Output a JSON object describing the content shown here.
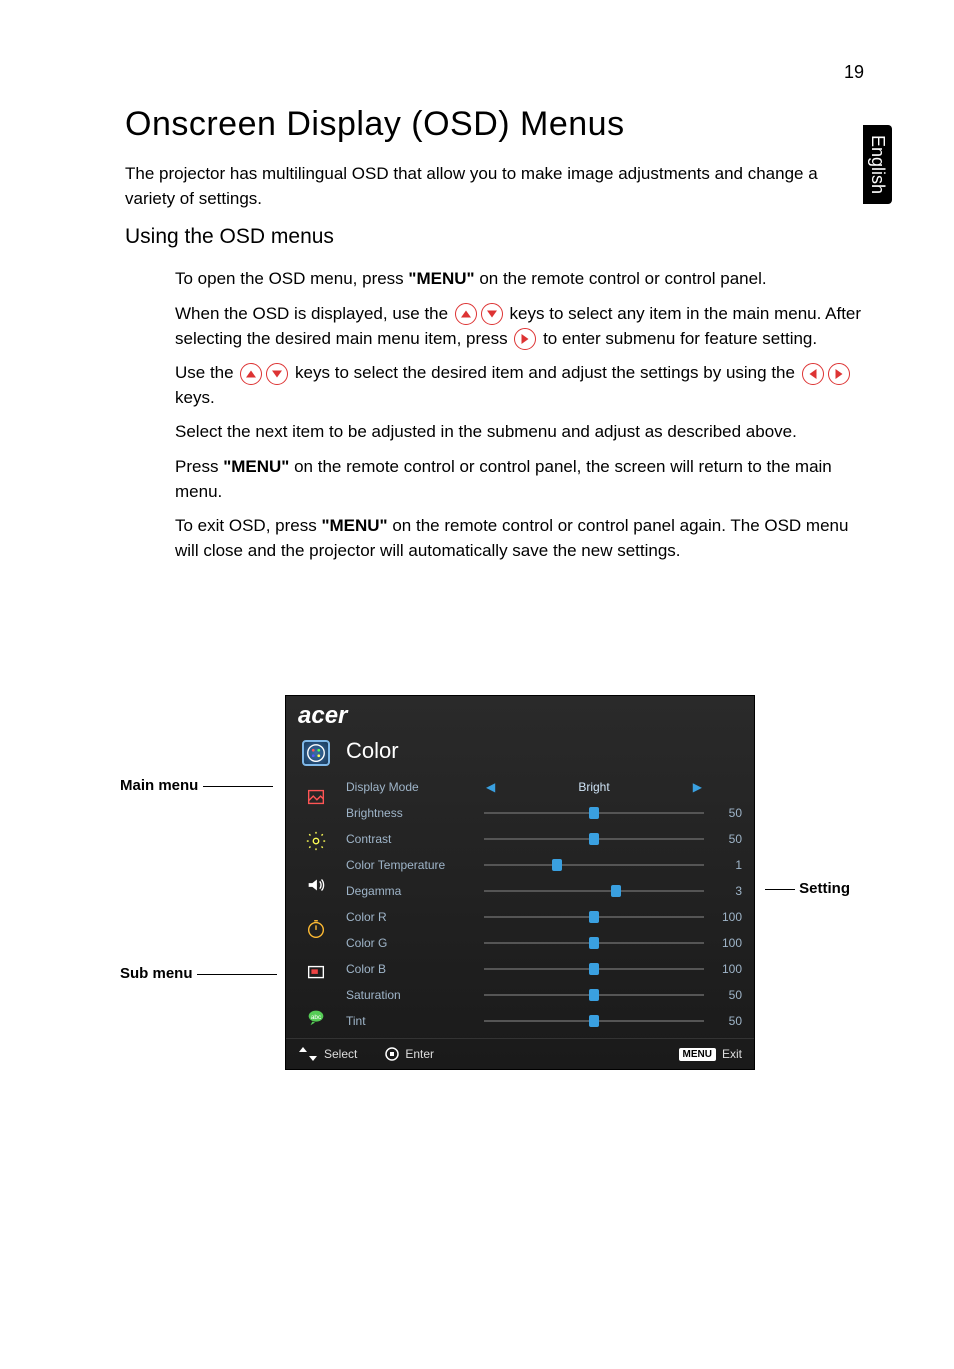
{
  "page_number": "19",
  "side_tab": "English",
  "heading": "Onscreen Display (OSD) Menus",
  "intro": "The projector has multilingual OSD that allow you to make image adjustments and change a variety of settings.",
  "subheading": "Using the OSD menus",
  "paras": {
    "p1a": "To open the OSD menu, press ",
    "p1b": "\"MENU\"",
    "p1c": " on the remote control or control panel.",
    "p2a": "When the OSD is displayed, use the ",
    "p2b": " keys to select any item in the main menu. After selecting the desired main menu item, press ",
    "p2c": " to enter submenu for feature setting.",
    "p3a": "Use the ",
    "p3b": " keys to select the desired item and adjust the settings by using the ",
    "p3c": " keys.",
    "p4": "Select the next item to be adjusted in the submenu and adjust as described above.",
    "p5a": "Press ",
    "p5b": "\"MENU\"",
    "p5c": " on the remote control or control panel, the screen will return to the main menu.",
    "p6a": "To exit OSD, press ",
    "p6b": "\"MENU\"",
    "p6c": " on the remote control or control panel again. The OSD menu will close and the projector will automatically save the new settings."
  },
  "labels": {
    "main_menu": "Main menu",
    "sub_menu": "Sub menu",
    "setting": "Setting"
  },
  "osd": {
    "logo": "acer",
    "title": "Color",
    "side_icons": [
      "color-palette-icon",
      "image-icon",
      "settings-gear-icon",
      "audio-icon",
      "timer-icon",
      "screen-icon",
      "language-icon"
    ],
    "rows": [
      {
        "label": "Display Mode",
        "type": "select",
        "value": "Bright"
      },
      {
        "label": "Brightness",
        "type": "slider",
        "value": 50,
        "max": 100
      },
      {
        "label": "Contrast",
        "type": "slider",
        "value": 50,
        "max": 100
      },
      {
        "label": "Color Temperature",
        "type": "slider",
        "value": 1,
        "max": 3
      },
      {
        "label": "Degamma",
        "type": "slider",
        "value": 3,
        "max": 5
      },
      {
        "label": "Color R",
        "type": "slider",
        "value": 100,
        "max": 200
      },
      {
        "label": "Color G",
        "type": "slider",
        "value": 100,
        "max": 200
      },
      {
        "label": "Color B",
        "type": "slider",
        "value": 100,
        "max": 200
      },
      {
        "label": "Saturation",
        "type": "slider",
        "value": 50,
        "max": 100
      },
      {
        "label": "Tint",
        "type": "slider",
        "value": 50,
        "max": 100
      }
    ],
    "footer": {
      "select": "Select",
      "enter": "Enter",
      "menu_badge": "MENU",
      "exit": "Exit"
    }
  }
}
